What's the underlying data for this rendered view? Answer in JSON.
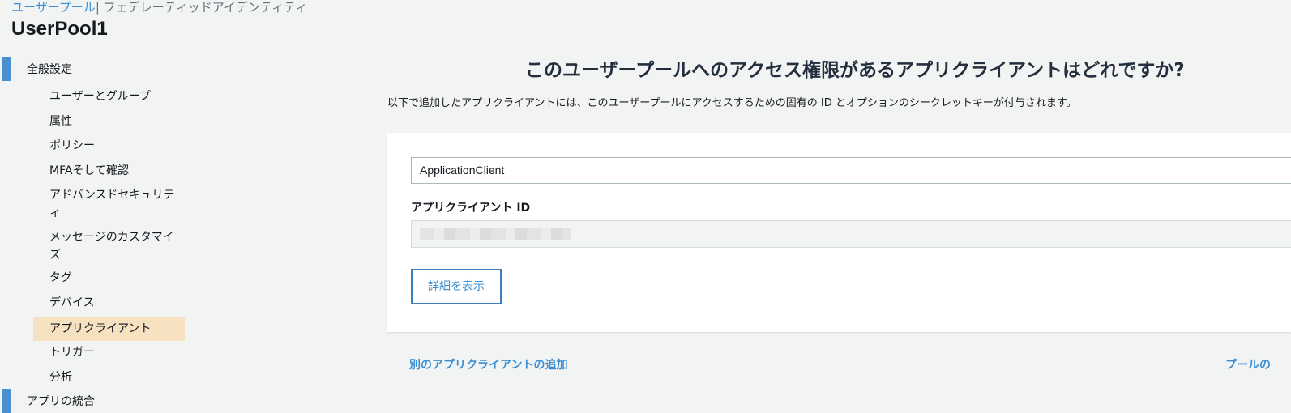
{
  "header": {
    "breadcrumb": {
      "link": "ユーザープール",
      "separator": "|",
      "current": "フェデレーティッドアイデンティティ"
    },
    "title": "UserPool1"
  },
  "sidebar": {
    "section_general": "全般設定",
    "items": [
      {
        "label": "ユーザーとグループ"
      },
      {
        "label": "属性"
      },
      {
        "label": "ポリシー"
      },
      {
        "label": "MFAそして確認"
      },
      {
        "label": "アドバンスドセキュリティ"
      },
      {
        "label": "メッセージのカスタマイズ"
      },
      {
        "label": "タグ"
      },
      {
        "label": "デバイス"
      },
      {
        "label": "アプリクライアント",
        "active": true
      },
      {
        "label": "トリガー"
      },
      {
        "label": "分析"
      }
    ],
    "section_integration": "アプリの統合"
  },
  "main": {
    "heading": "このユーザープールへのアクセス権限があるアプリクライアントはどれですか?",
    "description": "以下で追加したアプリクライアントには、このユーザープールにアクセスするための固有の ID とオプションのシークレットキーが付与されます。",
    "client": {
      "name": "ApplicationClient",
      "id_label": "アプリクライアント ID",
      "details_button": "詳細を表示"
    },
    "add_client_link": "別のアプリクライアントの追加",
    "return_link": "プールの"
  },
  "colors": {
    "accent": "#3b8fd3",
    "section_bar": "#4a90d0",
    "active_item_bg": "#f6e2c1",
    "page_bg": "#f2f3f3"
  }
}
